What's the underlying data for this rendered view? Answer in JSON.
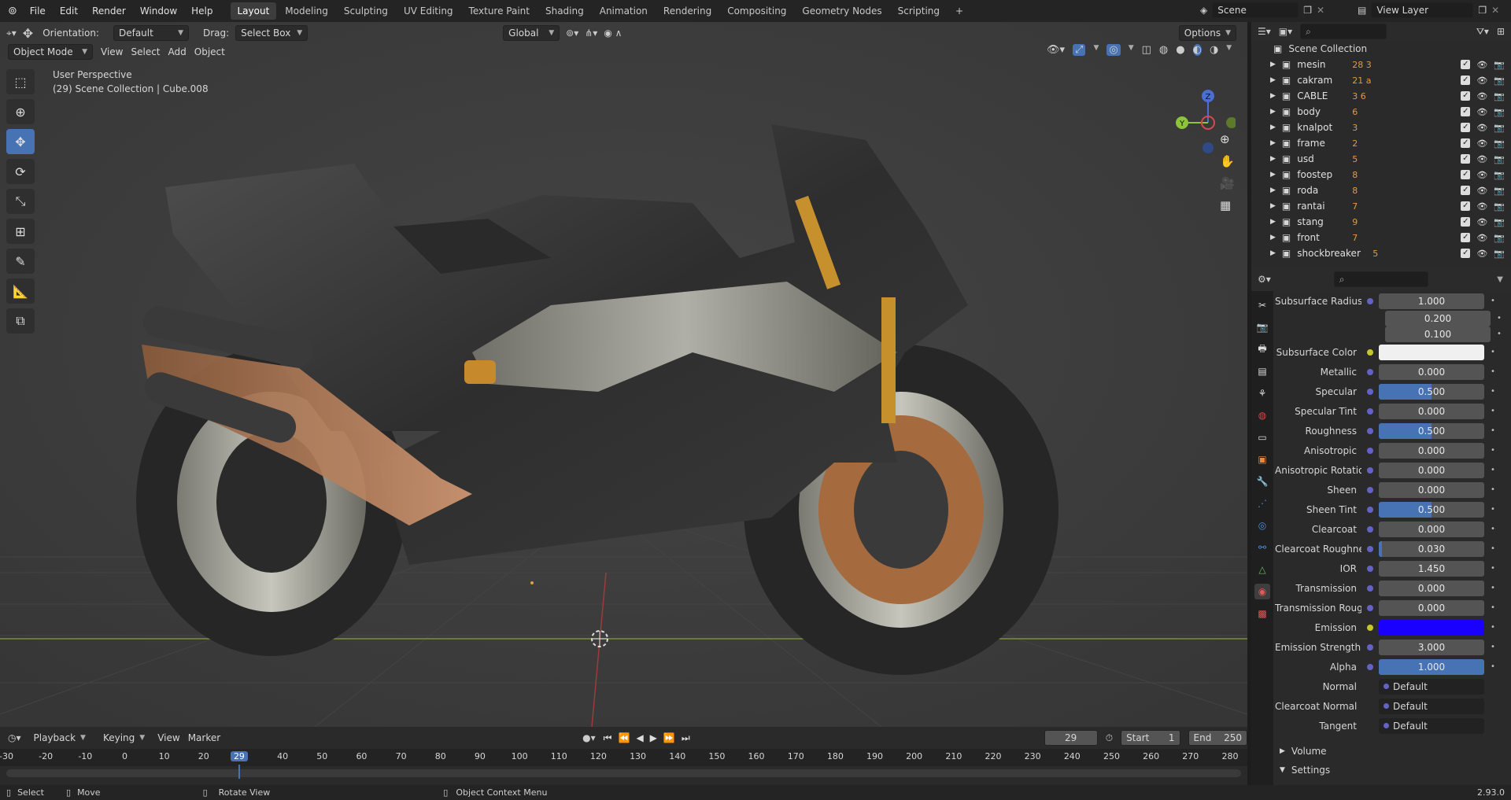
{
  "topbar": {
    "menus": [
      "File",
      "Edit",
      "Render",
      "Window",
      "Help"
    ],
    "workspaces": [
      "Layout",
      "Modeling",
      "Sculpting",
      "UV Editing",
      "Texture Paint",
      "Shading",
      "Animation",
      "Rendering",
      "Compositing",
      "Geometry Nodes",
      "Scripting"
    ],
    "active_workspace": "Layout",
    "scene": "Scene",
    "view_layer": "View Layer"
  },
  "viewport": {
    "orientation_label": "Orientation:",
    "orientation_value": "Default",
    "drag_label": "Drag:",
    "drag_value": "Select Box",
    "transform_orientation": "Global",
    "options": "Options",
    "mode": "Object Mode",
    "menus": [
      "View",
      "Select",
      "Add",
      "Object"
    ],
    "overlay_title": "User Perspective",
    "overlay_subtitle": "(29) Scene Collection | Cube.008",
    "gizmo": {
      "z": "Z",
      "y": "Y"
    }
  },
  "outliner": {
    "root": "Scene Collection",
    "items": [
      {
        "name": "mesin",
        "badge": "28 3"
      },
      {
        "name": "cakram",
        "badge": "21 a"
      },
      {
        "name": "CABLE",
        "badge": "3 6"
      },
      {
        "name": "body",
        "badge": "6"
      },
      {
        "name": "knalpot",
        "badge": "3"
      },
      {
        "name": "frame",
        "badge": "2"
      },
      {
        "name": "usd",
        "badge": "5"
      },
      {
        "name": "foostep",
        "badge": "8"
      },
      {
        "name": "roda",
        "badge": "8"
      },
      {
        "name": "rantai",
        "badge": "7"
      },
      {
        "name": "stang",
        "badge": "9"
      },
      {
        "name": "front",
        "badge": "7"
      },
      {
        "name": "shockbreaker",
        "badge": "5"
      }
    ]
  },
  "properties": {
    "subsurface_radius": {
      "label": "Subsurface Radius",
      "values": [
        "1.000",
        "0.200",
        "0.100"
      ]
    },
    "rows": [
      {
        "label": "Subsurface Color",
        "type": "color",
        "color": "#f0f0f0",
        "socket": "yellow"
      },
      {
        "label": "Metallic",
        "value": "0.000",
        "fill": 0
      },
      {
        "label": "Specular",
        "value": "0.500",
        "fill": 0.5
      },
      {
        "label": "Specular Tint",
        "value": "0.000",
        "fill": 0
      },
      {
        "label": "Roughness",
        "value": "0.500",
        "fill": 0.5
      },
      {
        "label": "Anisotropic",
        "value": "0.000",
        "fill": 0
      },
      {
        "label": "Anisotropic Rotation",
        "value": "0.000",
        "fill": 0
      },
      {
        "label": "Sheen",
        "value": "0.000",
        "fill": 0
      },
      {
        "label": "Sheen Tint",
        "value": "0.500",
        "fill": 0.5
      },
      {
        "label": "Clearcoat",
        "value": "0.000",
        "fill": 0
      },
      {
        "label": "Clearcoat Roughnes",
        "value": "0.030",
        "fill": 0.03
      },
      {
        "label": "IOR",
        "value": "1.450",
        "fill": 0
      },
      {
        "label": "Transmission",
        "value": "0.000",
        "fill": 0
      },
      {
        "label": "Transmission Roug...",
        "value": "0.000",
        "fill": 0
      },
      {
        "label": "Emission",
        "type": "color",
        "color": "#1a00ff",
        "socket": "yellow"
      },
      {
        "label": "Emission Strength",
        "value": "3.000",
        "fill": 0
      },
      {
        "label": "Alpha",
        "value": "1.000",
        "fill": 1
      }
    ],
    "links": [
      {
        "label": "Normal",
        "value": "Default"
      },
      {
        "label": "Clearcoat Normal",
        "value": "Default"
      },
      {
        "label": "Tangent",
        "value": "Default"
      }
    ],
    "sections": [
      "Volume",
      "Settings"
    ]
  },
  "timeline": {
    "menus": [
      "Playback",
      "Keying",
      "View",
      "Marker"
    ],
    "current_frame": "29",
    "start_label": "Start",
    "start": "1",
    "end_label": "End",
    "end": "250",
    "ruler": [
      "-30",
      "-20",
      "-10",
      "0",
      "10",
      "20",
      "29",
      "40",
      "50",
      "60",
      "70",
      "80",
      "90",
      "100",
      "110",
      "120",
      "130",
      "140",
      "150",
      "160",
      "170",
      "180",
      "190",
      "200",
      "210",
      "220",
      "230",
      "240",
      "250",
      "260",
      "270",
      "280"
    ]
  },
  "statusbar": {
    "select": "Select",
    "move": "Move",
    "rotate": "Rotate View",
    "context": "Object Context Menu",
    "version": "2.93.0"
  }
}
